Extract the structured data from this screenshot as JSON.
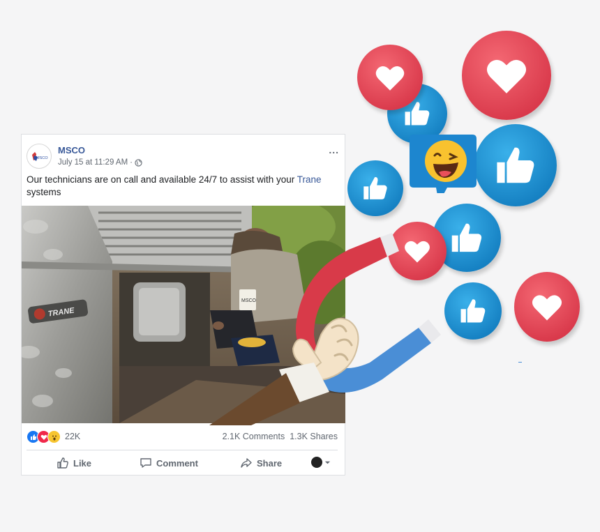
{
  "post": {
    "page_name": "MSCO",
    "avatar_text": "MSCO",
    "timestamp": "July 15 at 11:29 AM",
    "separator": "·",
    "more_icon": "...",
    "text_before_link": "Our technicians are on call and available 24/7 to assist with your ",
    "link_text": "Trane",
    "text_after_link": " systems",
    "photo_brand_text": "TRANE",
    "photo_badge_text": "MSCO"
  },
  "stats": {
    "reactions_count": "22K",
    "comments": "2.1K Comments",
    "shares": "1.3K Shares",
    "reaction_icons": [
      "like-icon",
      "love-icon",
      "wow-icon"
    ]
  },
  "actions": {
    "like": "Like",
    "comment": "Comment",
    "share": "Share"
  },
  "colors": {
    "link": "#385898",
    "heart": "#e0424f",
    "like": "#1d8fd3",
    "magnet_red": "#d83a49",
    "magnet_blue": "#4a8ed6"
  },
  "decorations": [
    "heart-bubble",
    "like-bubble",
    "laughing-emoji-speech-bubble",
    "horseshoe-magnet",
    "hand-holding-magnet"
  ]
}
